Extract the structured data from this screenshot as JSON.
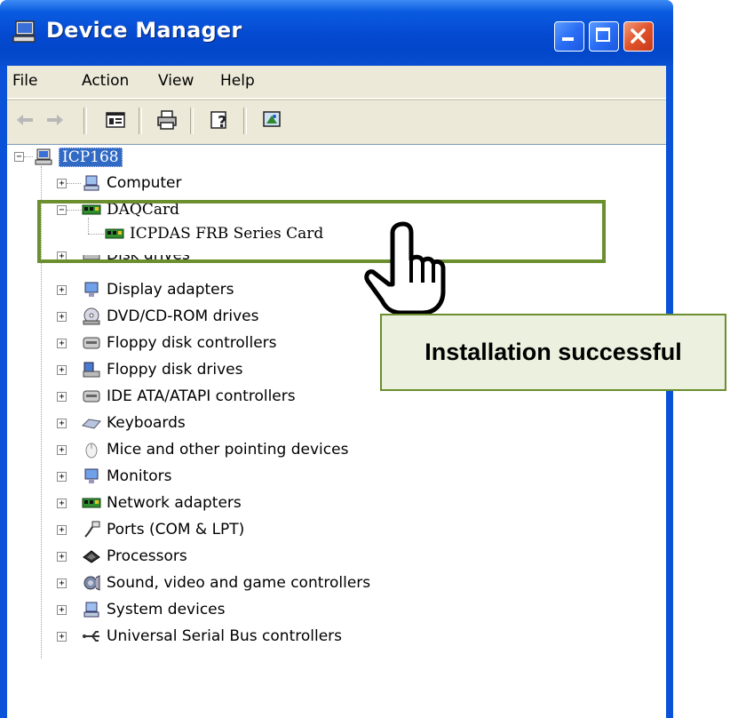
{
  "window": {
    "title": "Device Manager",
    "icon": "computer-icon"
  },
  "menu": {
    "items": [
      "File",
      "Action",
      "View",
      "Help"
    ]
  },
  "toolbar": {
    "buttons": [
      "back-icon",
      "forward-icon",
      "properties-pane-icon",
      "print-icon",
      "help-icon",
      "scan-hardware-icon"
    ]
  },
  "tree": {
    "root": "ICP168",
    "items": [
      {
        "label": "Computer",
        "icon": "computer-icon"
      },
      {
        "label": "DAQCard",
        "icon": "card-icon"
      },
      {
        "label": "ICPDAS FRB Series Card",
        "icon": "card-icon"
      },
      {
        "label": "Disk drives",
        "icon": "disk-icon"
      },
      {
        "label": "Display adapters",
        "icon": "monitor-icon"
      },
      {
        "label": "DVD/CD-ROM drives",
        "icon": "cd-icon"
      },
      {
        "label": "Floppy disk controllers",
        "icon": "controller-icon"
      },
      {
        "label": "Floppy disk drives",
        "icon": "floppy-icon"
      },
      {
        "label": "IDE ATA/ATAPI controllers",
        "icon": "controller-icon"
      },
      {
        "label": "Keyboards",
        "icon": "keyboard-icon"
      },
      {
        "label": "Mice and other pointing devices",
        "icon": "mouse-icon"
      },
      {
        "label": "Monitors",
        "icon": "monitor-icon"
      },
      {
        "label": "Network adapters",
        "icon": "network-card-icon"
      },
      {
        "label": "Ports (COM & LPT)",
        "icon": "port-icon"
      },
      {
        "label": "Processors",
        "icon": "processor-icon"
      },
      {
        "label": "Sound, video and game controllers",
        "icon": "sound-icon"
      },
      {
        "label": "System devices",
        "icon": "system-icon"
      },
      {
        "label": "Universal Serial Bus controllers",
        "icon": "usb-icon"
      }
    ]
  },
  "annotation": {
    "callout": "Installation successful",
    "accent": "#6b8e2f",
    "callout_fill": "#ebf1de"
  }
}
